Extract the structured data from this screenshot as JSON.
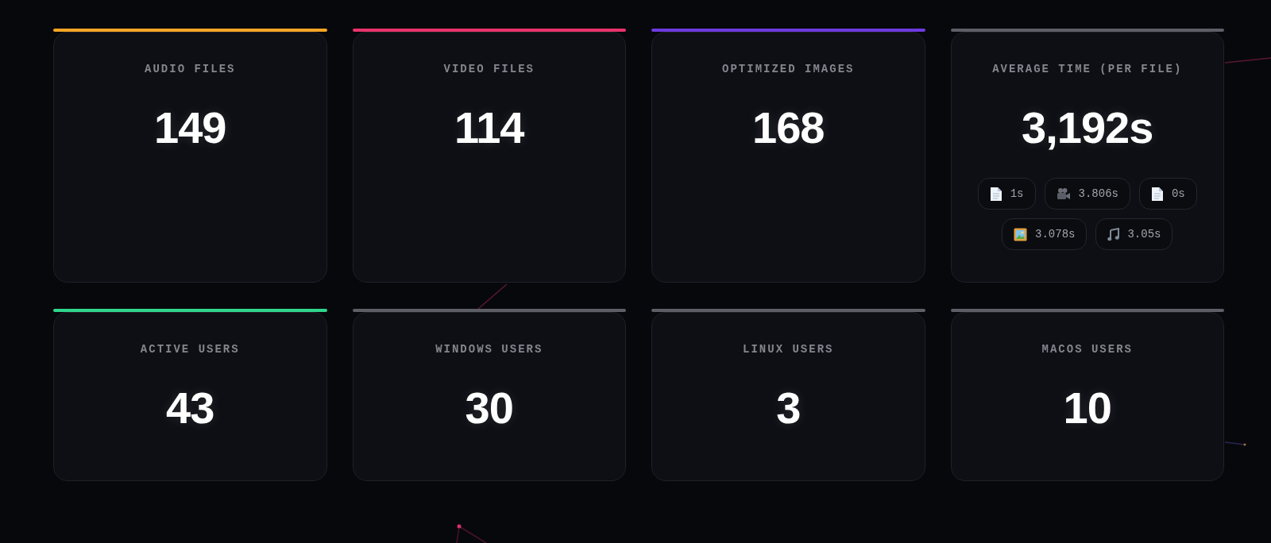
{
  "stats": [
    {
      "label": "AUDIO FILES",
      "value": "149",
      "color": "#f5a524"
    },
    {
      "label": "VIDEO FILES",
      "value": "114",
      "color": "#e8336b"
    },
    {
      "label": "OPTIMIZED IMAGES",
      "value": "168",
      "color": "#6d3ae0"
    },
    {
      "label": "AVERAGE TIME (PER FILE)",
      "value": "3,192s",
      "color": "#5d5e66",
      "breakdown": [
        {
          "kind": "document",
          "text": "1s"
        },
        {
          "kind": "video",
          "text": "3.806s"
        },
        {
          "kind": "document",
          "text": "0s"
        },
        {
          "kind": "image",
          "text": "3.078s"
        },
        {
          "kind": "music",
          "text": "3.05s"
        }
      ]
    },
    {
      "label": "ACTIVE USERS",
      "value": "43",
      "color": "#2fd68d"
    },
    {
      "label": "WINDOWS USERS",
      "value": "30",
      "color": "#5d5e66"
    },
    {
      "label": "LINUX USERS",
      "value": "3",
      "color": "#5d5e66"
    },
    {
      "label": "MACOS USERS",
      "value": "10",
      "color": "#5d5e66"
    }
  ]
}
